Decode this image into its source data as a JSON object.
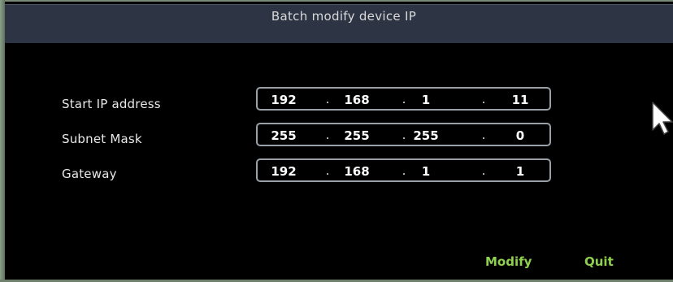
{
  "dialog": {
    "title": "Batch modify device IP"
  },
  "fields": [
    {
      "label": "Start IP address",
      "octets": [
        "192",
        "168",
        "1",
        "11"
      ]
    },
    {
      "label": "Subnet Mask",
      "octets": [
        "255",
        "255",
        "255",
        "0"
      ]
    },
    {
      "label": "Gateway",
      "octets": [
        "192",
        "168",
        "1",
        "1"
      ]
    }
  ],
  "separator": ".",
  "actions": {
    "modify_label": "Modify",
    "quit_label": "Quit"
  },
  "colors": {
    "background": "#000000",
    "title_bar": "#2d3443",
    "action_text": "#8fd14f",
    "field_border": "#9aa0a8"
  },
  "icons": {
    "cursor": "mouse-pointer-icon"
  }
}
